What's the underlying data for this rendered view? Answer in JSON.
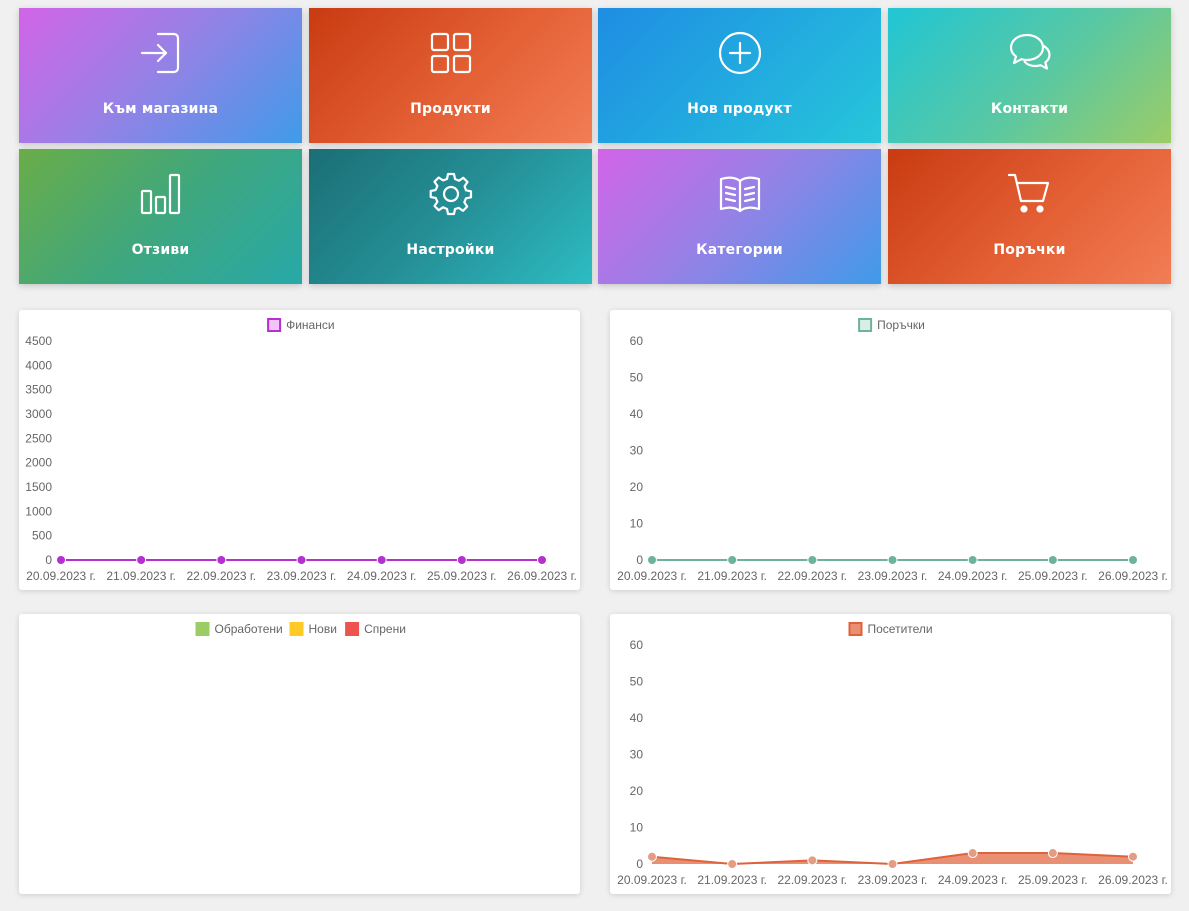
{
  "tiles": [
    {
      "label": "Към магазина",
      "icon": "sign-in-icon",
      "gradient": "g1",
      "name": "tile-to-store"
    },
    {
      "label": "Продукти",
      "icon": "grid-icon",
      "gradient": "g2",
      "name": "tile-products"
    },
    {
      "label": "Нов продукт",
      "icon": "plus-circle-icon",
      "gradient": "g3",
      "name": "tile-new-product"
    },
    {
      "label": "Контакти",
      "icon": "chat-bubbles-icon",
      "gradient": "g4",
      "name": "tile-contacts"
    },
    {
      "label": "Отзиви",
      "icon": "bar-chart-icon",
      "gradient": "g5",
      "name": "tile-reviews"
    },
    {
      "label": "Настройки",
      "icon": "gear-icon",
      "gradient": "g6",
      "name": "tile-settings"
    },
    {
      "label": "Категории",
      "icon": "open-book-icon",
      "gradient": "g1",
      "name": "tile-categories"
    },
    {
      "label": "Поръчки",
      "icon": "shopping-cart-icon",
      "gradient": "g2",
      "name": "tile-orders"
    }
  ],
  "chart_data": [
    {
      "type": "line",
      "x": [
        "20.09.2023 г.",
        "21.09.2023 г.",
        "22.09.2023 г.",
        "23.09.2023 г.",
        "24.09.2023 г.",
        "25.09.2023 г.",
        "26.09.2023 г."
      ],
      "series": [
        {
          "name": "Финанси",
          "values": [
            0,
            0,
            0,
            0,
            0,
            0,
            0
          ],
          "color": "#b52fd1",
          "fill": "#f3c4f9"
        }
      ],
      "yticks": [
        0,
        500,
        1000,
        1500,
        2000,
        2500,
        3000,
        3500,
        4000,
        4500
      ],
      "ylim": [
        0,
        4500
      ],
      "legend": "top-center",
      "grid": false
    },
    {
      "type": "line",
      "x": [
        "20.09.2023 г.",
        "21.09.2023 г.",
        "22.09.2023 г.",
        "23.09.2023 г.",
        "24.09.2023 г.",
        "25.09.2023 г.",
        "26.09.2023 г."
      ],
      "series": [
        {
          "name": "Поръчки",
          "values": [
            0,
            0,
            0,
            0,
            0,
            0,
            0
          ],
          "color": "#6db39b",
          "fill": "#d9eee6"
        }
      ],
      "yticks": [
        0,
        10,
        20,
        30,
        40,
        50,
        60
      ],
      "ylim": [
        0,
        60
      ],
      "legend": "top-center",
      "grid": false
    },
    {
      "type": "pie",
      "categories": [
        "Обработени",
        "Нови",
        "Спрени"
      ],
      "values": [
        0,
        0,
        0
      ],
      "colors": [
        "#9ccc65",
        "#ffca28",
        "#ef5350"
      ],
      "legend": "top-center"
    },
    {
      "type": "area",
      "x": [
        "20.09.2023 г.",
        "21.09.2023 г.",
        "22.09.2023 г.",
        "23.09.2023 г.",
        "24.09.2023 г.",
        "25.09.2023 г.",
        "26.09.2023 г."
      ],
      "series": [
        {
          "name": "Посетители",
          "values": [
            2,
            0,
            1,
            0,
            3,
            3,
            2
          ],
          "color": "#e0623a",
          "fill": "#e98f74",
          "point": "#e49c82"
        }
      ],
      "yticks": [
        0,
        10,
        20,
        30,
        40,
        50,
        60
      ],
      "ylim": [
        0,
        60
      ],
      "legend": "top-center",
      "grid": false
    }
  ]
}
